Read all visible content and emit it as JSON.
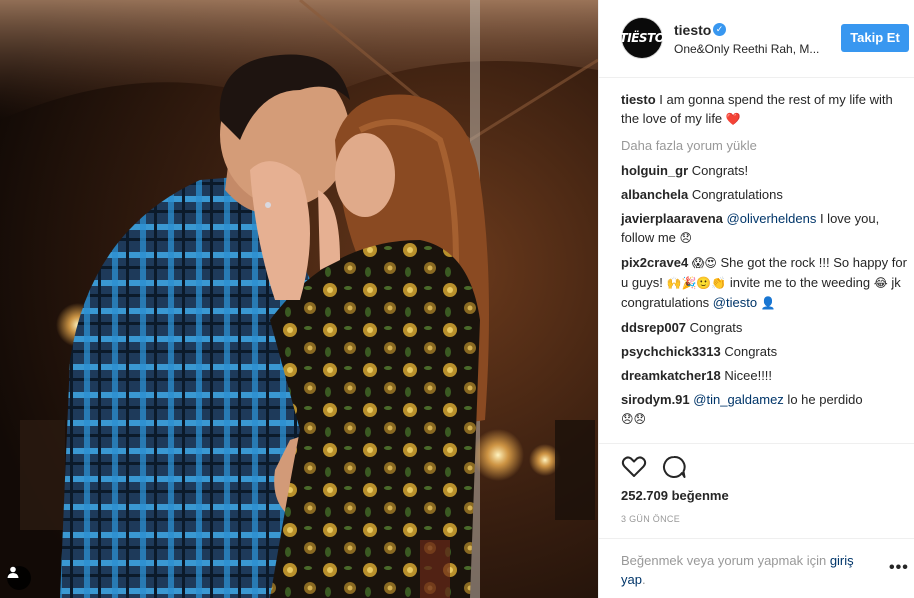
{
  "header": {
    "avatar_text": "TIËSTO",
    "username": "tiesto",
    "verified_mark": "✓",
    "location": "One&Only Reethi Rah, M...",
    "follow_label": "Takip Et"
  },
  "caption": {
    "user": "tiesto",
    "text": " I am gonna spend the rest of my life with the love of my life ",
    "emoji": "❤️"
  },
  "load_more": "Daha fazla yorum yükle",
  "comments": [
    {
      "user": "holguin_gr",
      "text": " Congrats!"
    },
    {
      "user": "albanchela",
      "text": " Congratulations"
    },
    {
      "user": "javierplaaravena",
      "mention": "@oliverheldens",
      "text": " I love you, follow me ",
      "emoji": "😞"
    },
    {
      "user": "pix2crave4",
      "emoji1": "😱😍",
      "text": " She got the rock !!! So happy for u guys! ",
      "emoji2": "🙌🎉🙂👏",
      "text2": " invite me to the weeding ",
      "emoji3": "😂",
      "text3": " jk congratulations ",
      "mention": "@tiesto",
      "emoji4": "👤"
    },
    {
      "user": "ddsrep007",
      "text": " Congrats"
    },
    {
      "user": "psychchick3313",
      "text": " Congrats"
    },
    {
      "user": "dreamkatcher18",
      "text": " Nicee!!!!"
    },
    {
      "user": "sirodym.91",
      "mention": "@tin_galdamez",
      "text": " lo he perdido",
      "emoji": "😞😞"
    }
  ],
  "actions": {
    "likes": "252.709 beğenme",
    "time": "3 GÜN ÖNCE"
  },
  "login": {
    "text": "Beğenmek veya yorum yapmak için ",
    "link": "giriş yap",
    "period": ".",
    "more": "•••"
  },
  "colors": {
    "accent": "#3897f0",
    "heart": "#ed4956",
    "mention": "#003569",
    "muted": "#999999"
  }
}
